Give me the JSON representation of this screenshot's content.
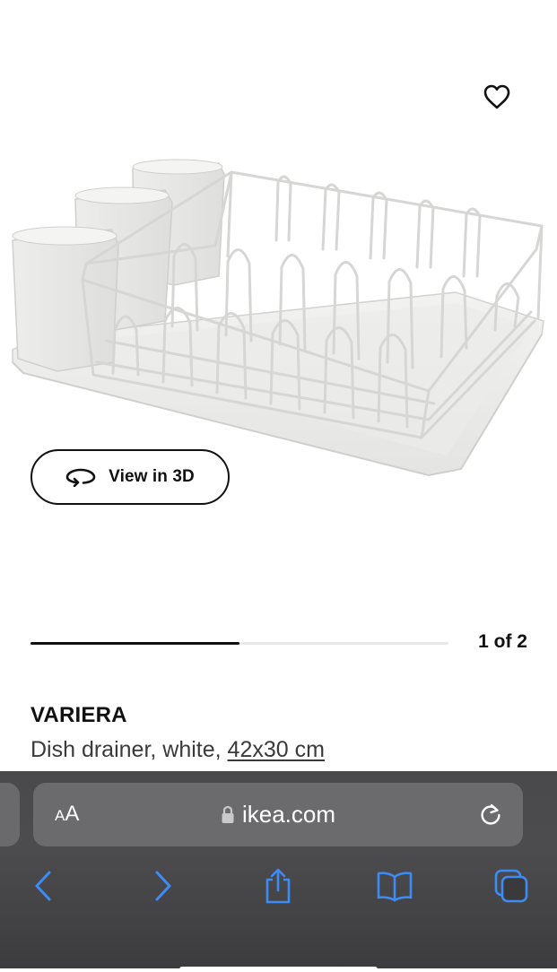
{
  "product": {
    "name": "VARIERA",
    "description": "Dish drainer, white, ",
    "size_link": "42x30 cm"
  },
  "view3d": {
    "label": "View in 3D"
  },
  "carousel": {
    "page_label": "1 of 2",
    "progress": 0.5
  },
  "browser": {
    "aa_small": "A",
    "aa_big": "A",
    "url": "ikea.com"
  },
  "icons": {
    "favorite": "heart-icon",
    "view3d": "rotate-3d-icon",
    "lock": "lock-icon",
    "reload": "reload-icon",
    "back": "chevron-left-icon",
    "forward": "chevron-right-icon",
    "share": "share-icon",
    "bookmarks": "book-icon",
    "tabs": "tabs-icon"
  },
  "colors": {
    "accent": "#3d8cf5",
    "text": "#111111",
    "browser_bg": "#4a4a4c",
    "address_bg": "#6b6b6e"
  }
}
